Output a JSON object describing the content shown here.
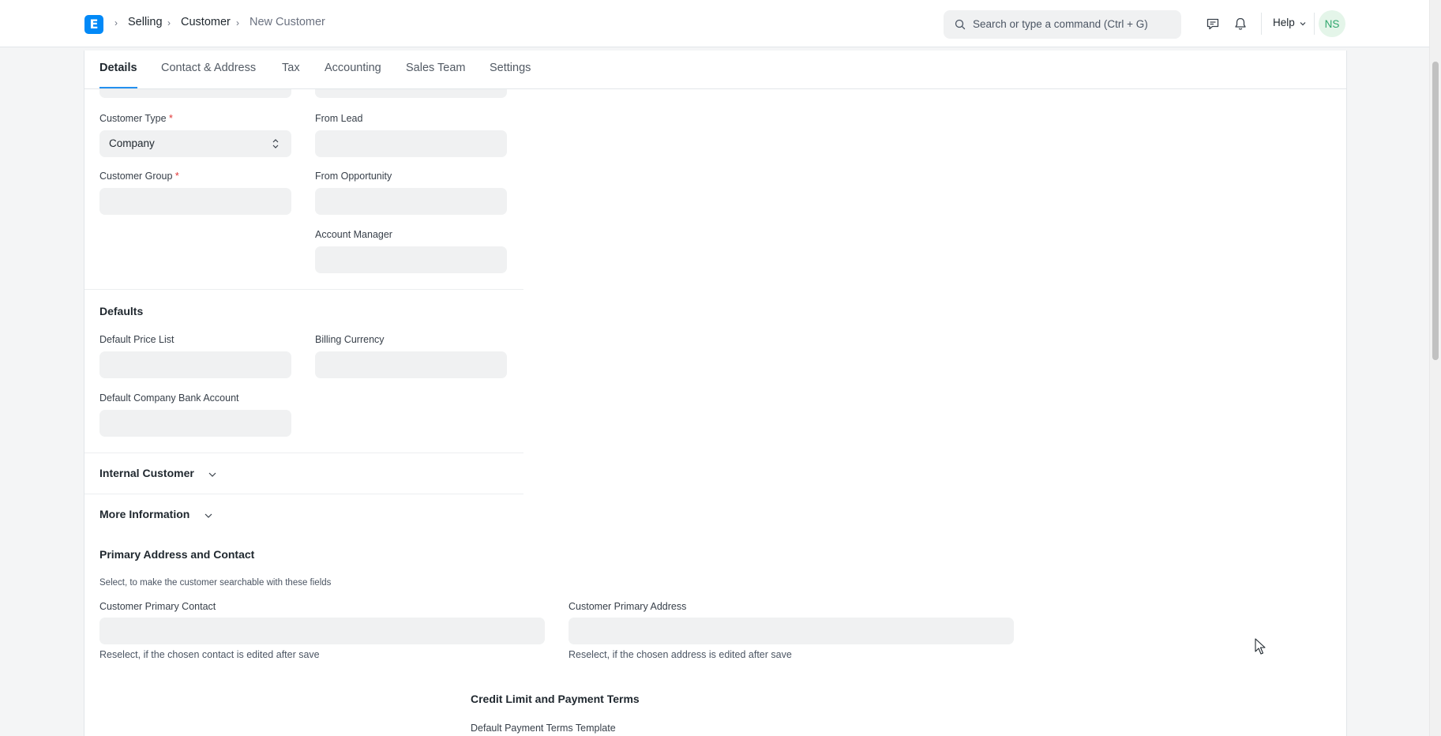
{
  "breadcrumbs": [
    "Selling",
    "Customer",
    "New Customer"
  ],
  "search": {
    "placeholder": "Search or type a command (Ctrl + G)"
  },
  "navbar": {
    "help_label": "Help",
    "avatar_initials": "NS"
  },
  "tabs": [
    "Details",
    "Contact & Address",
    "Tax",
    "Accounting",
    "Sales Team",
    "Settings"
  ],
  "fields": {
    "customer_type": {
      "label": "Customer Type",
      "value": "Company",
      "required": "*"
    },
    "customer_group": {
      "label": "Customer Group",
      "value": "",
      "required": "*"
    },
    "from_lead": {
      "label": "From Lead",
      "value": ""
    },
    "from_opportunity": {
      "label": "From Opportunity",
      "value": ""
    },
    "account_manager": {
      "label": "Account Manager",
      "value": ""
    },
    "default_price_list": {
      "label": "Default Price List",
      "value": ""
    },
    "billing_currency": {
      "label": "Billing Currency",
      "value": ""
    },
    "default_company_bank_account": {
      "label": "Default Company Bank Account",
      "value": ""
    },
    "customer_primary_contact": {
      "label": "Customer Primary Contact",
      "value": "",
      "help": "Reselect, if the chosen contact is edited after save"
    },
    "customer_primary_address": {
      "label": "Customer Primary Address",
      "value": "",
      "help": "Reselect, if the chosen address is edited after save"
    },
    "default_payment_terms_template": {
      "label": "Default Payment Terms Template"
    }
  },
  "sections": {
    "defaults": "Defaults",
    "internal_customer": "Internal Customer",
    "more_information": "More Information",
    "primary_address_contact": "Primary Address and Contact",
    "primary_address_contact_desc": "Select, to make the customer searchable with these fields",
    "credit_limit": "Credit Limit and Payment Terms"
  },
  "colors": {
    "accent": "#2490ef",
    "logo": "#0289f7",
    "required": "#e03636",
    "avatar_text": "#30a66d"
  }
}
